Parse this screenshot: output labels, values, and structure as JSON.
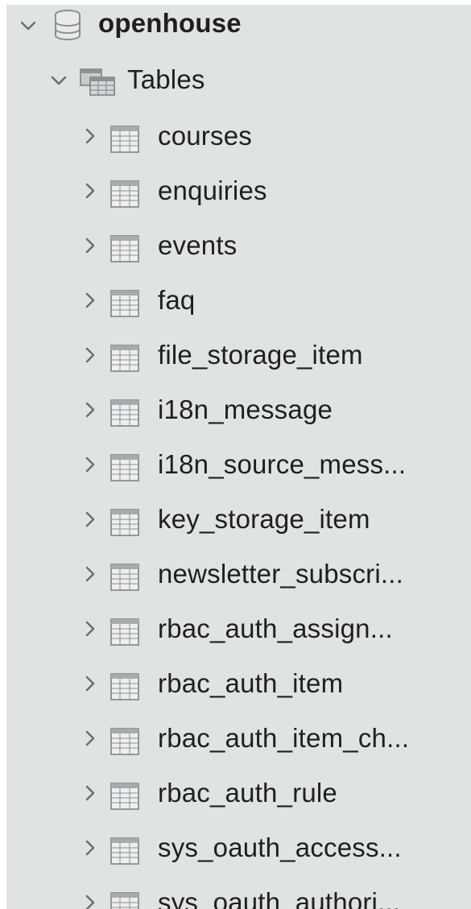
{
  "tree": {
    "database": {
      "label": "openhouse",
      "icon": "database-icon",
      "expanded": true
    },
    "group": {
      "label": "Tables",
      "icon": "tables-folder-icon",
      "expanded": true
    },
    "tables": [
      {
        "label": "courses",
        "icon": "table-icon"
      },
      {
        "label": "enquiries",
        "icon": "table-icon"
      },
      {
        "label": "events",
        "icon": "table-icon"
      },
      {
        "label": "faq",
        "icon": "table-icon"
      },
      {
        "label": "file_storage_item",
        "icon": "table-icon"
      },
      {
        "label": "i18n_message",
        "icon": "table-icon"
      },
      {
        "label": "i18n_source_mess...",
        "icon": "table-icon"
      },
      {
        "label": "key_storage_item",
        "icon": "table-icon"
      },
      {
        "label": "newsletter_subscri...",
        "icon": "table-icon"
      },
      {
        "label": "rbac_auth_assign...",
        "icon": "table-icon"
      },
      {
        "label": "rbac_auth_item",
        "icon": "table-icon"
      },
      {
        "label": "rbac_auth_item_ch...",
        "icon": "table-icon"
      },
      {
        "label": "rbac_auth_rule",
        "icon": "table-icon"
      },
      {
        "label": "sys_oauth_access...",
        "icon": "table-icon"
      },
      {
        "label": "sys_oauth_authori...",
        "icon": "table-icon"
      }
    ]
  },
  "colors": {
    "panel_bg": "#dfe3e2",
    "text": "#1f1f1f",
    "chevron": "#6a6d6d",
    "icon_stroke": "#8b8e90"
  }
}
